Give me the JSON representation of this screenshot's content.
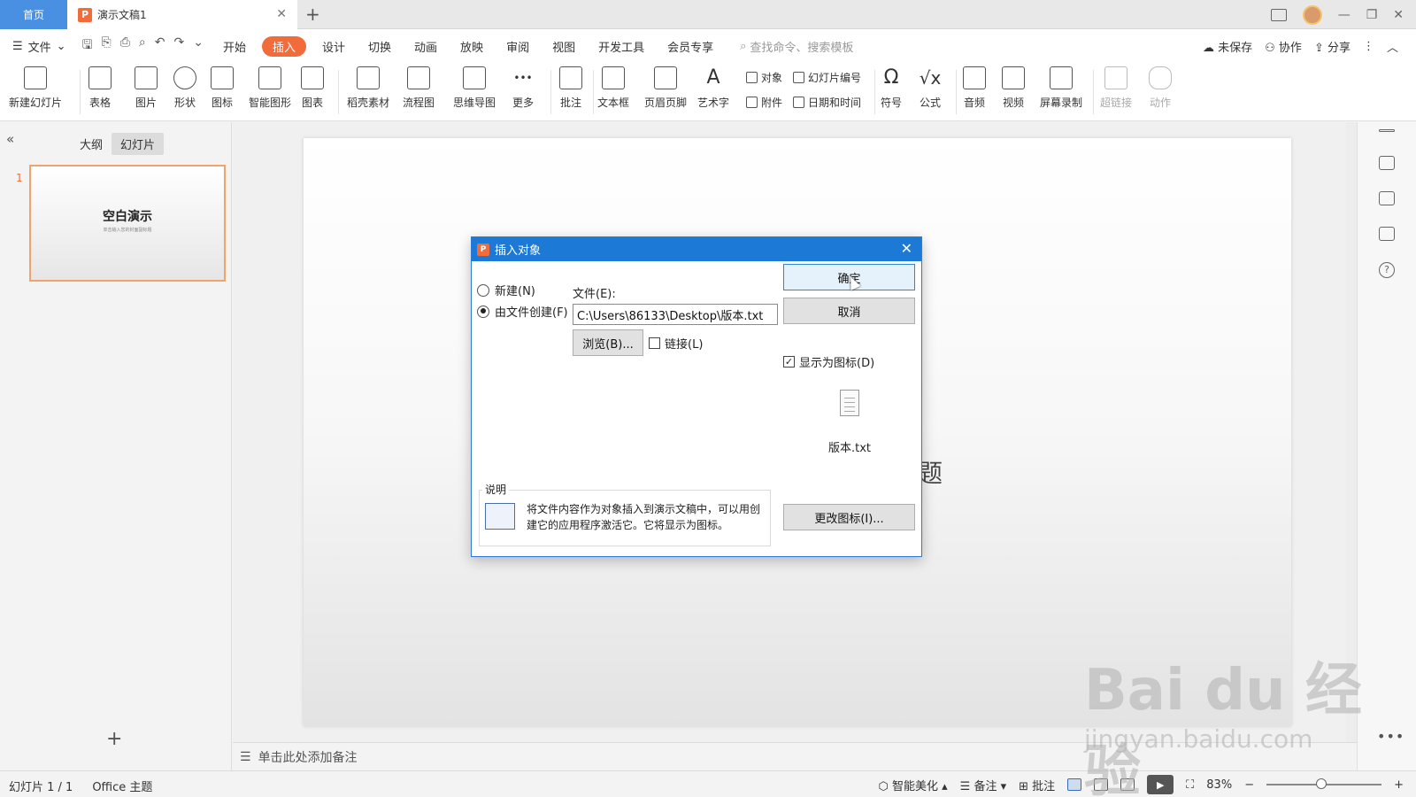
{
  "titlebar": {
    "home_tab": "首页",
    "doc_tab": "演示文稿1",
    "doc_icon_letter": "P",
    "add_tab": "+",
    "close": "✕",
    "minimize": "—",
    "restore": "❐",
    "window_close": "✕"
  },
  "menubar": {
    "file": "文件",
    "items": [
      "开始",
      "插入",
      "设计",
      "切换",
      "动画",
      "放映",
      "审阅",
      "视图",
      "开发工具",
      "会员专享"
    ],
    "active": "插入",
    "search_placeholder": "查找命令、搜索模板",
    "unsaved": "未保存",
    "collab": "协作",
    "share": "分享"
  },
  "ribbon": {
    "new_slide": "新建幻灯片",
    "table": "表格",
    "picture": "图片",
    "shape": "形状",
    "icon": "图标",
    "smartart": "智能图形",
    "chart": "图表",
    "material": "稻壳素材",
    "flowchart": "流程图",
    "mindmap": "思维导图",
    "more": "更多",
    "comment": "批注",
    "textbox": "文本框",
    "header_footer": "页眉页脚",
    "wordart": "艺术字",
    "object": "对象",
    "slide_number": "幻灯片编号",
    "attachment": "附件",
    "datetime": "日期和时间",
    "symbol": "符号",
    "formula": "公式",
    "audio": "音频",
    "video": "视频",
    "screen_record": "屏幕录制",
    "hyperlink": "超链接",
    "action": "动作"
  },
  "leftpanel": {
    "tab_outline": "大纲",
    "tab_slides": "幻灯片",
    "slide_number": "1",
    "thumb_title": "空白演示",
    "thumb_subtitle": "单击输入您的封面副标题",
    "add": "+"
  },
  "slide": {
    "fragment": "题"
  },
  "notes": {
    "placeholder": "单击此处添加备注"
  },
  "dialog": {
    "title": "插入对象",
    "icon_letter": "P",
    "close": "✕",
    "radio_new": "新建(N)",
    "radio_from_file": "由文件创建(F)",
    "file_label": "文件(E):",
    "file_path": "C:\\Users\\86133\\Desktop\\版本.txt",
    "browse": "浏览(B)...",
    "link": "链接(L)",
    "ok": "确定",
    "cancel": "取消",
    "show_as_icon": "显示为图标(D)",
    "show_as_icon_checked": true,
    "link_checked": false,
    "file_caption": "版本.txt",
    "desc_legend": "说明",
    "desc_text": "将文件内容作为对象插入到演示文稿中，可以用创建它的应用程序激活它。它将显示为图标。",
    "change_icon": "更改图标(I)..."
  },
  "statusbar": {
    "slide_count": "幻灯片 1 / 1",
    "theme": "Office 主题",
    "beautify": "智能美化",
    "notes": "备注",
    "comment": "批注",
    "zoom": "83%",
    "zoom_minus": "−",
    "zoom_plus": "+"
  },
  "watermark": {
    "main": "Bai du 经验",
    "sub": "jingyan.baidu.com"
  },
  "colors": {
    "accent": "#f26b3a",
    "dialog_title": "#1c79d6",
    "home_tab": "#4a90e2"
  }
}
